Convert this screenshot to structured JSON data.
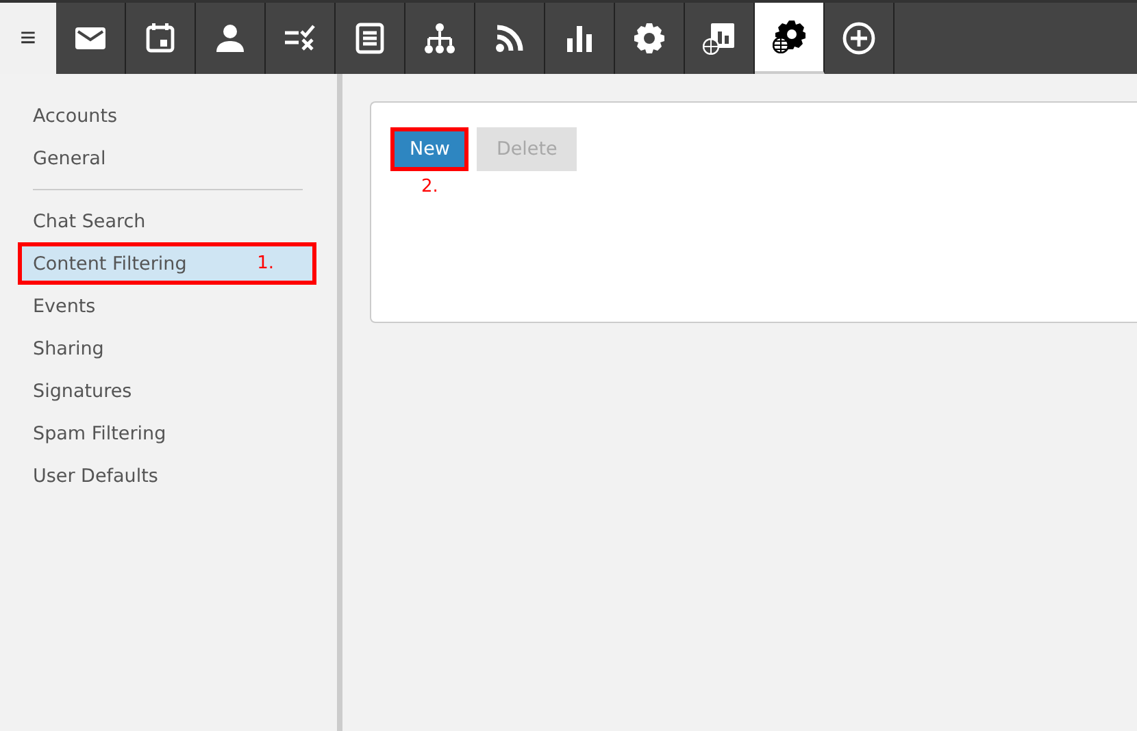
{
  "toolbar": {
    "menu_glyph": "≡",
    "tabs": [
      {
        "kind": "mail",
        "selected": false
      },
      {
        "kind": "calendar",
        "selected": false
      },
      {
        "kind": "contact",
        "selected": false
      },
      {
        "kind": "tasks",
        "selected": false
      },
      {
        "kind": "notes",
        "selected": false
      },
      {
        "kind": "tree",
        "selected": false
      },
      {
        "kind": "rss",
        "selected": false
      },
      {
        "kind": "chart",
        "selected": false
      },
      {
        "kind": "gear",
        "selected": false
      },
      {
        "kind": "report-globe",
        "selected": false
      },
      {
        "kind": "gear-globe",
        "selected": true
      },
      {
        "kind": "plus",
        "selected": false
      }
    ]
  },
  "sidebar": {
    "groups": [
      [
        {
          "label": "Accounts",
          "selected": false
        },
        {
          "label": "General",
          "selected": false
        }
      ],
      [
        {
          "label": "Chat Search",
          "selected": false
        },
        {
          "label": "Content Filtering",
          "selected": true,
          "callout": "1."
        },
        {
          "label": "Events",
          "selected": false
        },
        {
          "label": "Sharing",
          "selected": false
        },
        {
          "label": "Signatures",
          "selected": false
        },
        {
          "label": "Spam Filtering",
          "selected": false
        },
        {
          "label": "User Defaults",
          "selected": false
        }
      ]
    ]
  },
  "panel": {
    "buttons": [
      {
        "label": "New",
        "disabled": false,
        "callout": "2."
      },
      {
        "label": "Delete",
        "disabled": true
      }
    ]
  }
}
